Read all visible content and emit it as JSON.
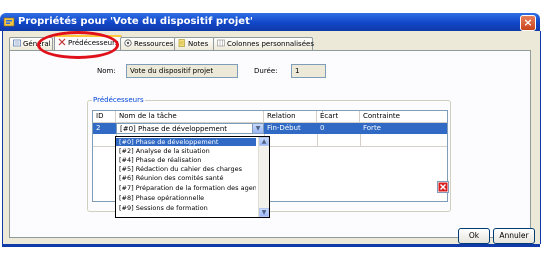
{
  "window": {
    "title": "Propriétés pour 'Vote du dispositif projet'",
    "close_symbol": "×"
  },
  "tabs": [
    {
      "label": "Général",
      "icon": "general-icon"
    },
    {
      "label": "Prédécesseurs",
      "icon": "predecessors-icon"
    },
    {
      "label": "Ressources",
      "icon": "resources-icon"
    },
    {
      "label": "Notes",
      "icon": "notes-icon"
    },
    {
      "label": "Colonnes personnalisées",
      "icon": "columns-icon"
    }
  ],
  "form": {
    "name_label": "Nom:",
    "name_value": "Vote du dispositif projet",
    "duration_label": "Durée:",
    "duration_value": "1"
  },
  "group": {
    "title": "Prédécesseurs"
  },
  "table": {
    "headers": [
      "ID",
      "Nom de la tâche",
      "Relation",
      "Écart",
      "Contrainte"
    ],
    "rows": [
      {
        "id": "2",
        "task": "[#0] Phase de développement",
        "relation": "Fin-Début",
        "gap": "0",
        "constraint": "Forte"
      }
    ]
  },
  "dropdown": {
    "options": [
      "[#0] Phase de développement",
      "[#2] Analyse de la situation",
      "[#4] Phase de réalisation",
      "[#5] Rédaction du cahier des charges",
      "[#6] Réunion des comités santé",
      "[#7] Préparation de la formation des agen",
      "[#8] Phase opérationnelle",
      "[#9] Sessions de formation"
    ],
    "selected_index": 0
  },
  "buttons": {
    "ok": "Ok",
    "cancel": "Annuler"
  },
  "colors": {
    "title_bar": "#1246c8",
    "selection": "#316ac5",
    "highlight_circle": "#e0101a",
    "delete_icon": "#d81e1e"
  }
}
